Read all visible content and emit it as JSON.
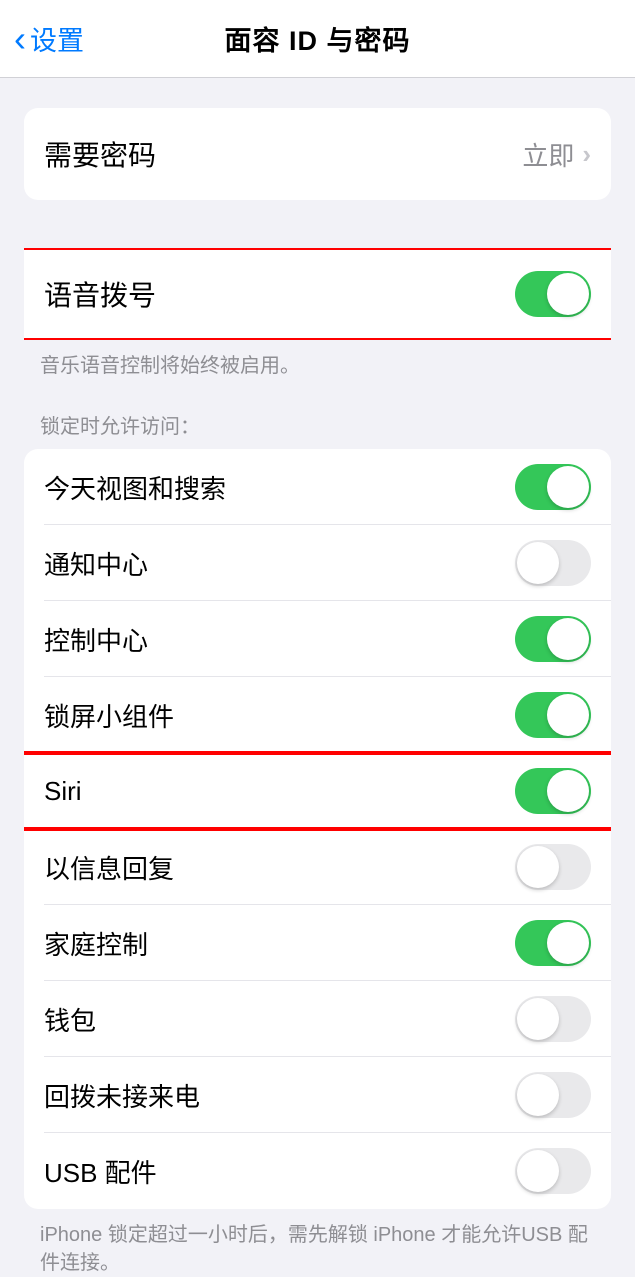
{
  "header": {
    "back_label": "设置",
    "title": "面容 ID 与密码"
  },
  "require_passcode": {
    "label": "需要密码",
    "value": "立即"
  },
  "voice_dial": {
    "label": "语音拨号",
    "enabled": true,
    "footer": "音乐语音控制将始终被启用。"
  },
  "lockscreen_access": {
    "header": "锁定时允许访问：",
    "items": [
      {
        "label": "今天视图和搜索",
        "enabled": true
      },
      {
        "label": "通知中心",
        "enabled": false
      },
      {
        "label": "控制中心",
        "enabled": true
      },
      {
        "label": "锁屏小组件",
        "enabled": true
      },
      {
        "label": "Siri",
        "enabled": true
      },
      {
        "label": "以信息回复",
        "enabled": false
      },
      {
        "label": "家庭控制",
        "enabled": true
      },
      {
        "label": "钱包",
        "enabled": false
      },
      {
        "label": "回拨未接来电",
        "enabled": false
      },
      {
        "label": "USB 配件",
        "enabled": false
      }
    ],
    "footer": "iPhone 锁定超过一小时后，需先解锁 iPhone 才能允许USB 配件连接。"
  }
}
